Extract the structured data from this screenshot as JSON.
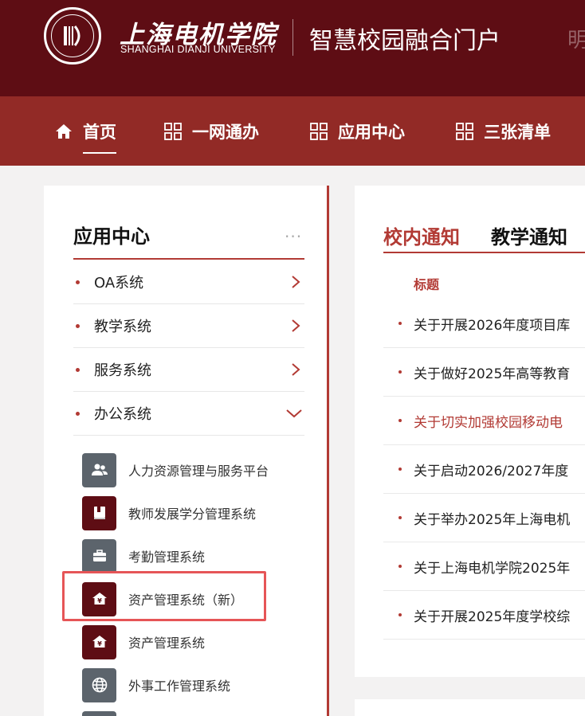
{
  "header": {
    "school_name_cn": "上海电机学院",
    "school_name_en": "SHANGHAI DIANJI UNIVERSITY",
    "portal_title": "智慧校园融合门户",
    "logo_icon": "university-seal-icon",
    "deco_char": "明"
  },
  "nav": {
    "items": [
      {
        "label": "首页",
        "icon": "home-icon"
      },
      {
        "label": "一网通办",
        "icon": "grid-icon"
      },
      {
        "label": "应用中心",
        "icon": "grid-icon"
      },
      {
        "label": "三张清单",
        "icon": "grid-icon"
      }
    ]
  },
  "app_center": {
    "title": "应用中心",
    "more": "···",
    "categories": [
      {
        "label": "OA系统",
        "expanded": false
      },
      {
        "label": "教学系统",
        "expanded": false
      },
      {
        "label": "服务系统",
        "expanded": false
      },
      {
        "label": "办公系统",
        "expanded": true
      }
    ],
    "sub_items": [
      {
        "label": "人力资源管理与服务平台",
        "icon": "users-icon",
        "color": "#5c646c"
      },
      {
        "label": "教师发展学分管理系统",
        "icon": "book-icon",
        "color": "#5e0d14"
      },
      {
        "label": "考勤管理系统",
        "icon": "briefcase-icon",
        "color": "#5c646c"
      },
      {
        "label": "资产管理系统（新）",
        "icon": "asset-house-icon",
        "color": "#5e0d14"
      },
      {
        "label": "资产管理系统",
        "icon": "asset-house-icon",
        "color": "#5e0d14"
      },
      {
        "label": "外事工作管理系统",
        "icon": "globe-icon",
        "color": "#5c646c"
      },
      {
        "label": "",
        "icon": "app-icon",
        "color": "#5c646c"
      }
    ]
  },
  "notices": {
    "tabs": [
      "校内通知",
      "教学通知"
    ],
    "column_header": "标题",
    "items": [
      {
        "title": "关于开展2026年度项目库",
        "hot": false
      },
      {
        "title": "关于做好2025年高等教育",
        "hot": false
      },
      {
        "title": "关于切实加强校园移动电",
        "hot": true
      },
      {
        "title": "关于启动2026/2027年度",
        "hot": false
      },
      {
        "title": "关于举办2025年上海电机",
        "hot": false
      },
      {
        "title": "关于上海电机学院2025年",
        "hot": false
      },
      {
        "title": "关于开展2025年度学校综",
        "hot": false
      }
    ]
  },
  "colors": {
    "header_bg": "#5e0d14",
    "nav_bg": "#922a26",
    "accent": "#b23a34",
    "highlight": "#e65557"
  }
}
